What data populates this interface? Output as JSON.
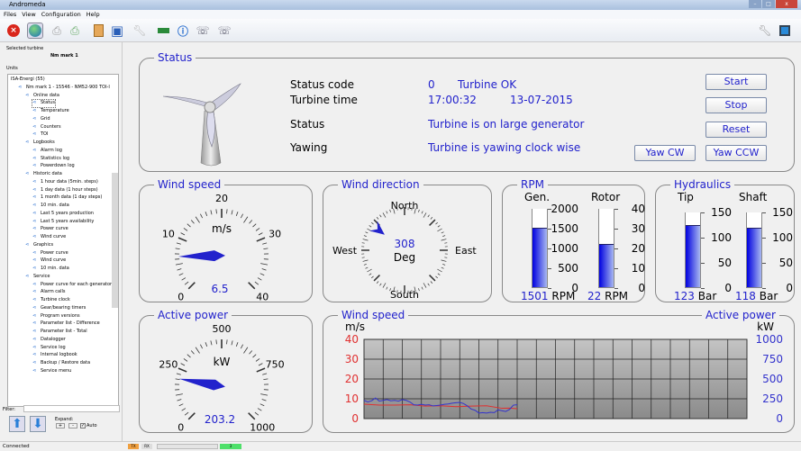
{
  "window": {
    "title": "Andromeda",
    "controls": [
      "–",
      "□",
      "x"
    ]
  },
  "menu": [
    "Files",
    "View",
    "Configuration",
    "Help"
  ],
  "toolbar": {
    "icons": [
      "close-icon",
      "globe-icon",
      "printer-icon",
      "print-preview-icon",
      "clipboard-icon",
      "save-icon",
      "wrench-icon",
      "usb-stick-icon",
      "info-icon",
      "phone-sum-icon",
      "phone-sync-icon"
    ],
    "right_icons": [
      "wrench-icon",
      "monitor-icon"
    ]
  },
  "left": {
    "selected_turbine_label": "Selected turbine",
    "selected_turbine": "Nm mark 1",
    "units_label": "Units",
    "filter_label": "Filter:",
    "filter_value": "",
    "expand_label": "Expand:",
    "expand_plus": "+",
    "expand_minus": "-",
    "auto_label": "Auto",
    "auto_checked": true,
    "tree": [
      {
        "label": "ISA-Energi (55)",
        "level": 0
      },
      {
        "label": "Nm mark 1 - 15546 - NM52-900 TOI-I",
        "level": 1
      },
      {
        "label": "Online data",
        "level": 2
      },
      {
        "label": "Status",
        "level": 3,
        "selected": true
      },
      {
        "label": "Temperature",
        "level": 3
      },
      {
        "label": "Grid",
        "level": 3
      },
      {
        "label": "Counters",
        "level": 3
      },
      {
        "label": "TOI",
        "level": 3
      },
      {
        "label": "Logbooks",
        "level": 2
      },
      {
        "label": "Alarm log",
        "level": 3
      },
      {
        "label": "Statistics log",
        "level": 3
      },
      {
        "label": "Powerdown log",
        "level": 3
      },
      {
        "label": "Historic data",
        "level": 2
      },
      {
        "label": "1 hour data (5min. steps)",
        "level": 3
      },
      {
        "label": "1 day data (1 hour steps)",
        "level": 3
      },
      {
        "label": "1 month data (1 day steps)",
        "level": 3
      },
      {
        "label": "10 min. data",
        "level": 3
      },
      {
        "label": "Last 5 years production",
        "level": 3
      },
      {
        "label": "Last 5 years availability",
        "level": 3
      },
      {
        "label": "Power curve",
        "level": 3
      },
      {
        "label": "Wind curve",
        "level": 3
      },
      {
        "label": "Graphics",
        "level": 2
      },
      {
        "label": "Power curve",
        "level": 3
      },
      {
        "label": "Wind curve",
        "level": 3
      },
      {
        "label": "10 min. data",
        "level": 3
      },
      {
        "label": "Service",
        "level": 2
      },
      {
        "label": "Power curve for each generator",
        "level": 3
      },
      {
        "label": "Alarm calls",
        "level": 3
      },
      {
        "label": "Turbine clock",
        "level": 3
      },
      {
        "label": "Gear/bearing timers",
        "level": 3
      },
      {
        "label": "Program versions",
        "level": 3
      },
      {
        "label": "Parameter list - Difference",
        "level": 3
      },
      {
        "label": "Parameter list - Total",
        "level": 3
      },
      {
        "label": "Datalogger",
        "level": 3
      },
      {
        "label": "Service log",
        "level": 3
      },
      {
        "label": "Internal logbook",
        "level": 3
      },
      {
        "label": "Backup / Restore data",
        "level": 3
      },
      {
        "label": "Service menu",
        "level": 3
      }
    ]
  },
  "statusbar": {
    "text": "Connected",
    "tx": "TX",
    "rx": "RX",
    "counter": "3"
  },
  "status": {
    "title": "Status",
    "code_label": "Status code",
    "code": "0",
    "code_text": "Turbine OK",
    "time_label": "Turbine time",
    "time": "17:00:32",
    "date": "13-07-2015",
    "status_label": "Status",
    "status_text": "Turbine is on large generator",
    "yawing_label": "Yawing",
    "yawing_text": "Turbine is yawing clock wise",
    "buttons": {
      "start": "Start",
      "stop": "Stop",
      "reset": "Reset",
      "yaw_cw": "Yaw CW",
      "yaw_ccw": "Yaw CCW"
    }
  },
  "wind_speed": {
    "title": "Wind speed",
    "unit": "m/s",
    "value": 6.5,
    "value_text": "6.5",
    "min": 0,
    "max": 40,
    "labels": [
      "0",
      "10",
      "20",
      "30",
      "40"
    ]
  },
  "wind_direction": {
    "title": "Wind direction",
    "value": 308,
    "value_text": "308",
    "unit": "Deg",
    "north": "North",
    "south": "South",
    "east": "East",
    "west": "West"
  },
  "rpm": {
    "title": "RPM",
    "gen": {
      "label": "Gen.",
      "value": 1501,
      "max": 2000,
      "ticks": [
        "2000",
        "1500",
        "1000",
        "500",
        "0"
      ],
      "value_text": "1501",
      "unit": "RPM"
    },
    "rotor": {
      "label": "Rotor",
      "value": 22,
      "max": 40,
      "ticks": [
        "40",
        "30",
        "20",
        "10",
        "0"
      ],
      "value_text": "22",
      "unit": "RPM"
    }
  },
  "hydraulics": {
    "title": "Hydraulics",
    "tip": {
      "label": "Tip",
      "value": 123,
      "max": 150,
      "ticks": [
        "150",
        "100",
        "50",
        "0"
      ],
      "value_text": "123",
      "unit": "Bar"
    },
    "shaft": {
      "label": "Shaft",
      "value": 118,
      "max": 150,
      "ticks": [
        "150",
        "100",
        "50",
        "0"
      ],
      "value_text": "118",
      "unit": "Bar"
    }
  },
  "active_power": {
    "title": "Active power",
    "unit": "kW",
    "value": 203.2,
    "value_text": "203.2",
    "min": 0,
    "max": 1000,
    "labels": [
      "0",
      "250",
      "500",
      "750",
      "1000"
    ]
  },
  "chart_data": {
    "type": "line",
    "title_left": "Wind speed",
    "title_right": "Active power",
    "ylabel_left": "m/s",
    "ylabel_right": "kW",
    "ylim_left": [
      0,
      40
    ],
    "ylim_right": [
      0,
      1000
    ],
    "yticks_left": [
      "40",
      "30",
      "20",
      "10",
      "0"
    ],
    "yticks_right": [
      "1000",
      "750",
      "500",
      "250",
      "0"
    ],
    "grid": true,
    "x_columns": 20,
    "xlim": [
      0,
      100
    ],
    "series": [
      {
        "axis": "left",
        "color": "#e03030",
        "x": [
          0,
          4,
          8,
          12,
          16,
          20,
          24,
          28,
          32,
          36,
          38,
          40
        ],
        "values": [
          7.3,
          6.8,
          6.8,
          7,
          6.3,
          6.5,
          6,
          6.3,
          6.5,
          5.2,
          5.3,
          5
        ]
      },
      {
        "axis": "right",
        "color": "#3333cc",
        "x": [
          0,
          1,
          2,
          3,
          4,
          5,
          6,
          7,
          8,
          9,
          10,
          11,
          12,
          13,
          14,
          15,
          16,
          17,
          18,
          19,
          20,
          21,
          22,
          23,
          24,
          25,
          26,
          27,
          28,
          29,
          30,
          31,
          32,
          33,
          34,
          35,
          36,
          37,
          38,
          39,
          40
        ],
        "values": [
          230,
          210,
          225,
          260,
          220,
          230,
          240,
          225,
          230,
          220,
          240,
          230,
          210,
          175,
          170,
          180,
          170,
          175,
          160,
          165,
          170,
          180,
          185,
          195,
          200,
          205,
          190,
          160,
          120,
          105,
          70,
          75,
          70,
          80,
          75,
          110,
          100,
          90,
          115,
          170,
          175
        ]
      }
    ]
  },
  "colors": {
    "accent": "#2222cc",
    "left_axis": "#e03030",
    "right_axis": "#3333cc"
  }
}
